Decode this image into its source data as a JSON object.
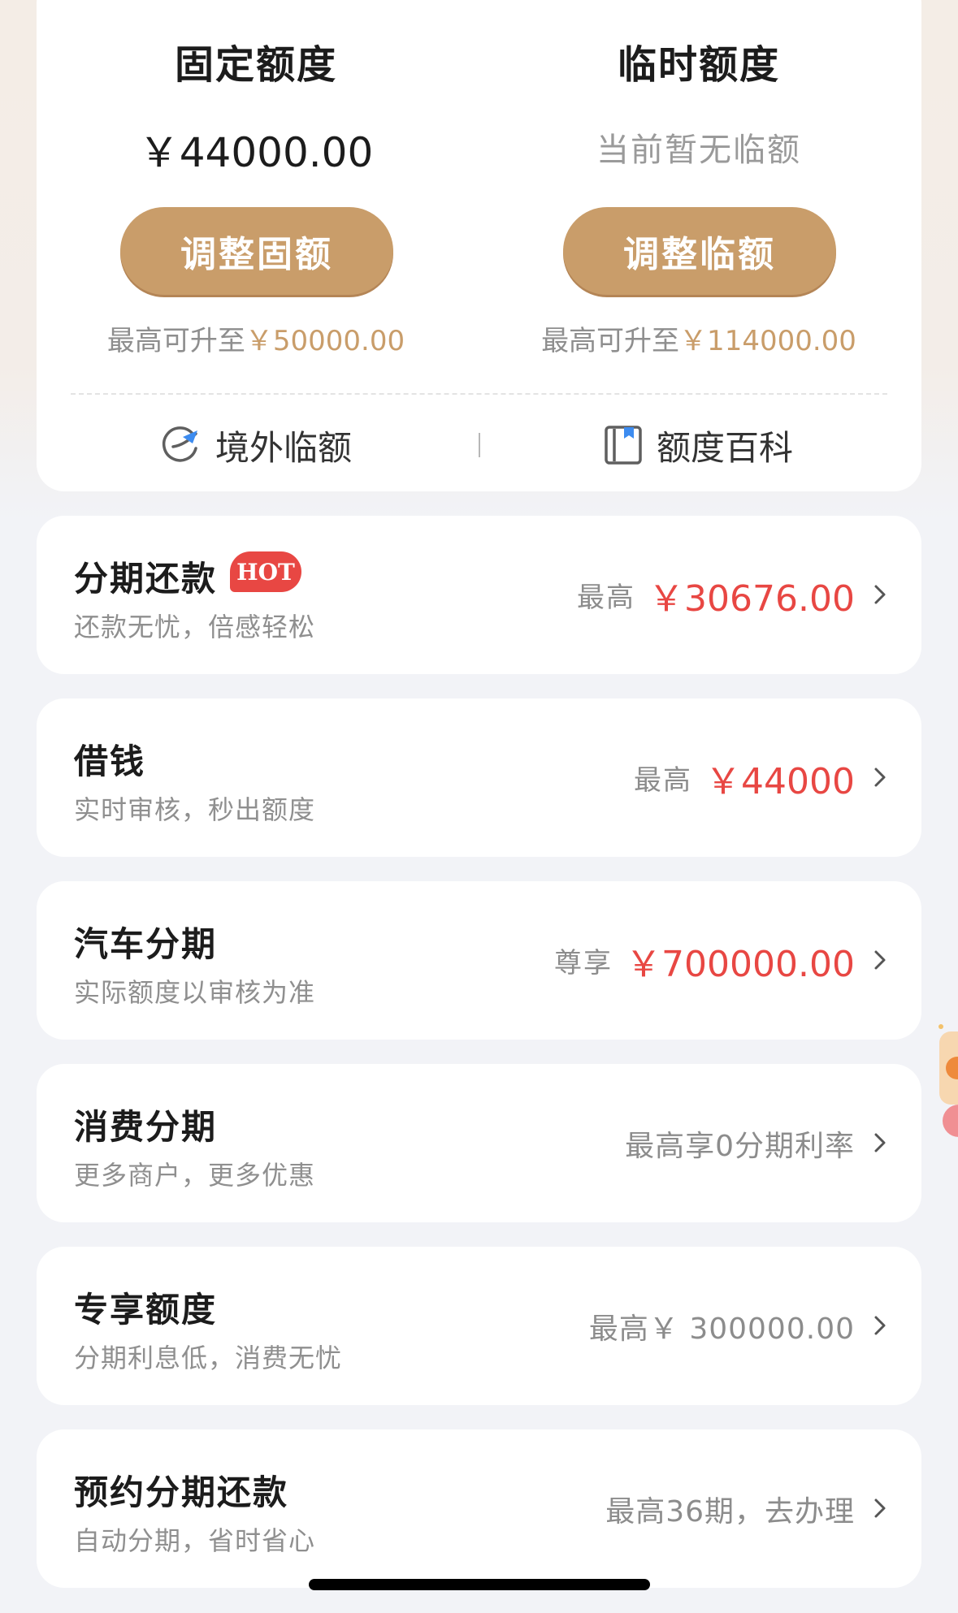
{
  "quota": {
    "fixed": {
      "title": "固定额度",
      "amount": "￥44000.00",
      "button": "调整固额",
      "max_prefix": "最高可升至",
      "max_value": "￥50000.00"
    },
    "temp": {
      "title": "临时额度",
      "status": "当前暂无临额",
      "button": "调整临额",
      "max_prefix": "最高可升至",
      "max_value": "￥114000.00"
    },
    "tools": {
      "overseas": "境外临额",
      "encyclopedia": "额度百科"
    }
  },
  "services": [
    {
      "title": "分期还款",
      "badge": "HOT",
      "subtitle": "还款无忧，倍感轻松",
      "prefix": "最高",
      "value": "￥30676.00"
    },
    {
      "title": "借钱",
      "subtitle": "实时审核，秒出额度",
      "prefix": "最高",
      "value": "￥44000"
    },
    {
      "title": "汽车分期",
      "subtitle": "实际额度以审核为准",
      "prefix": "尊享",
      "value": "￥700000.00"
    },
    {
      "title": "消费分期",
      "subtitle": "更多商户，更多优惠",
      "value": "最高享0分期利率"
    },
    {
      "title": "专享额度",
      "subtitle": "分期利息低，消费无忧",
      "value": "最高￥ 300000.00"
    },
    {
      "title": "预约分期还款",
      "subtitle": "自动分期，省时省心",
      "value": "最高36期，去办理"
    }
  ],
  "colors": {
    "accent_gold": "#c99d6a",
    "alert_red": "#e84743",
    "background": "#f2f3f7"
  }
}
